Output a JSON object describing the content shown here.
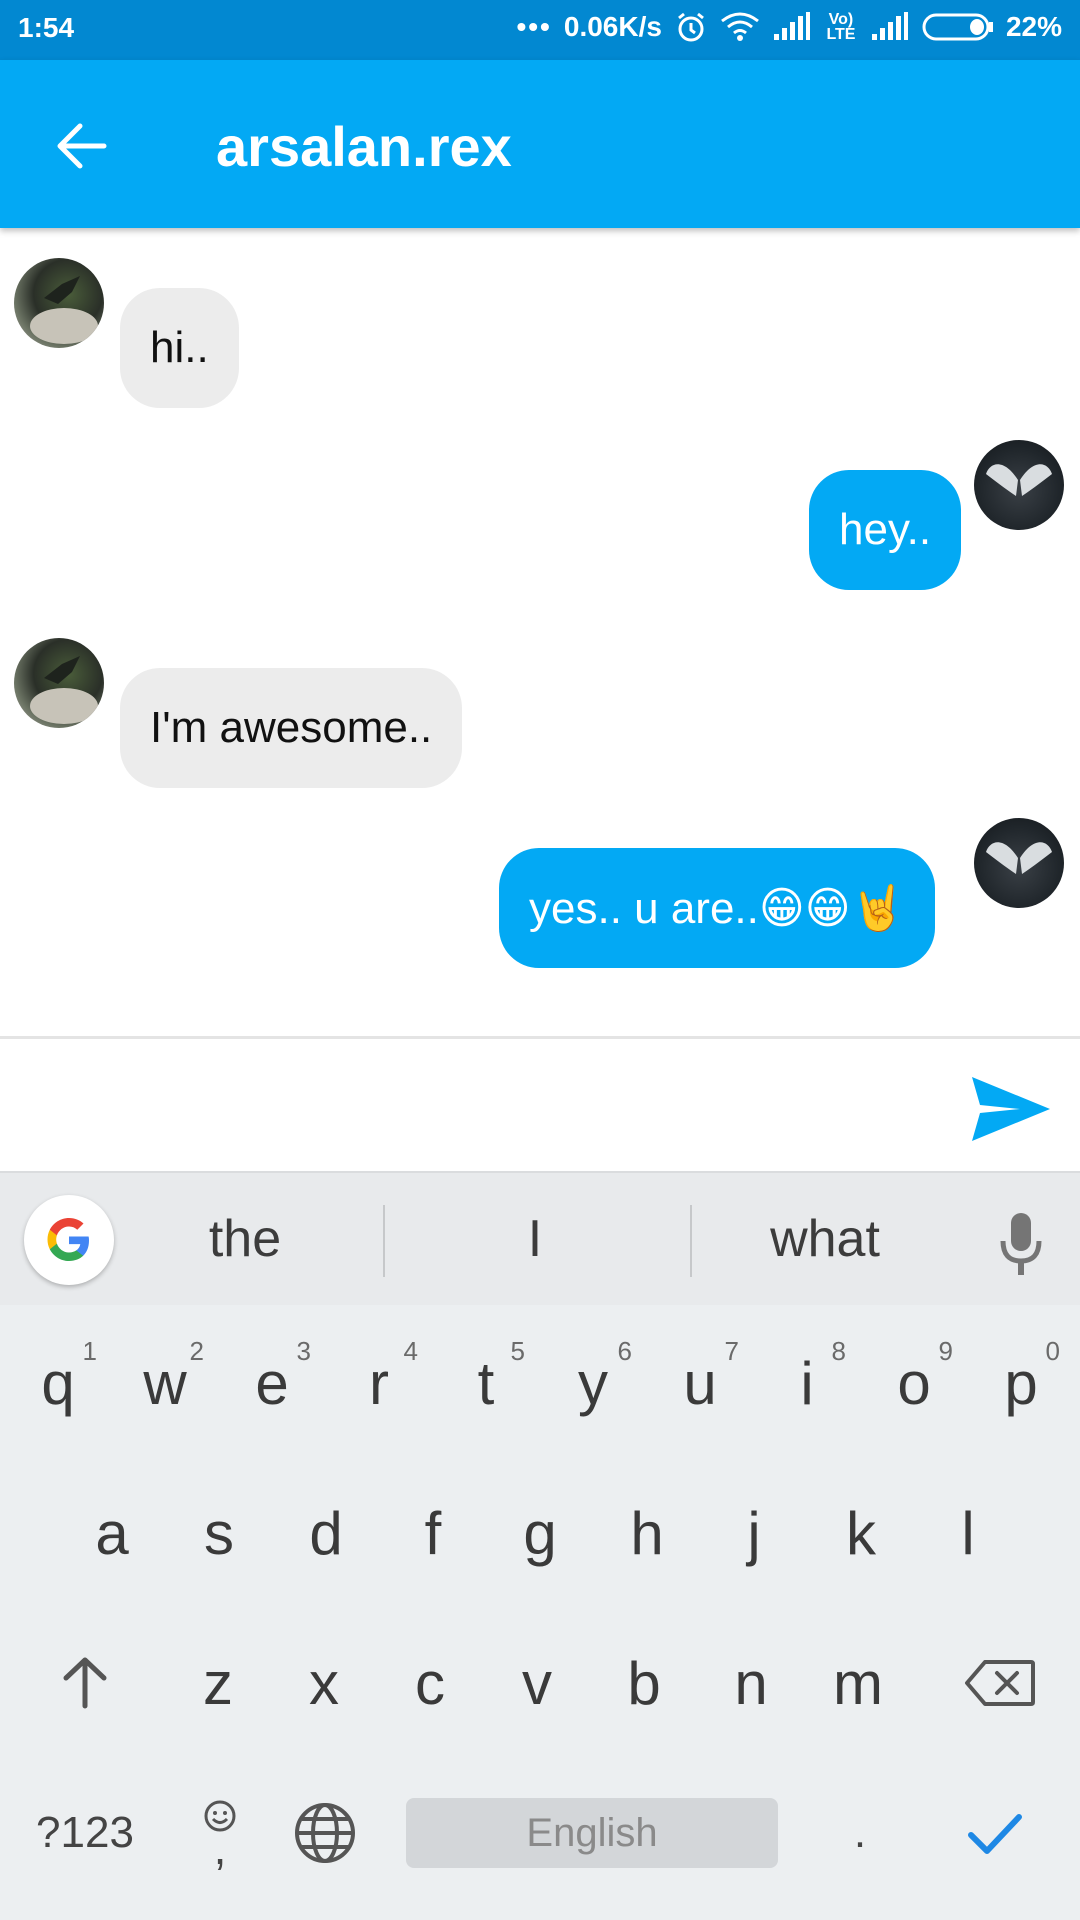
{
  "status_bar": {
    "time": "1:54",
    "network_speed": "0.06K/s",
    "volte_label": "Vo) LTE",
    "battery": "22%",
    "icons": [
      "more-dots-icon",
      "alarm-icon",
      "wifi-icon",
      "signal-icon",
      "volte-icon",
      "signal-icon-2",
      "battery-icon"
    ]
  },
  "app_bar": {
    "title": "arsalan.rex",
    "back_icon": "arrow-back-icon",
    "color": "#03a9f4"
  },
  "messages": [
    {
      "direction": "incoming",
      "text": "hi.."
    },
    {
      "direction": "outgoing",
      "text": "hey.."
    },
    {
      "direction": "incoming",
      "text": "I'm awesome.."
    },
    {
      "direction": "outgoing",
      "text": "yes.. u are..😁😁🤘"
    }
  ],
  "composer": {
    "value": "",
    "placeholder": "",
    "send_icon": "send-icon"
  },
  "keyboard": {
    "suggestions": [
      "the",
      "I",
      "what"
    ],
    "row1": [
      {
        "key": "q",
        "hint": "1"
      },
      {
        "key": "w",
        "hint": "2"
      },
      {
        "key": "e",
        "hint": "3"
      },
      {
        "key": "r",
        "hint": "4"
      },
      {
        "key": "t",
        "hint": "5"
      },
      {
        "key": "y",
        "hint": "6"
      },
      {
        "key": "u",
        "hint": "7"
      },
      {
        "key": "i",
        "hint": "8"
      },
      {
        "key": "o",
        "hint": "9"
      },
      {
        "key": "p",
        "hint": "0"
      }
    ],
    "row2": [
      "a",
      "s",
      "d",
      "f",
      "g",
      "h",
      "j",
      "k",
      "l"
    ],
    "row3": [
      "z",
      "x",
      "c",
      "v",
      "b",
      "n",
      "m"
    ],
    "symbols_label": "?123",
    "comma_label": ",",
    "space_label": "English",
    "period_label": ".",
    "icons": [
      "google-icon",
      "mic-icon",
      "shift-icon",
      "backspace-icon",
      "emoji-icon",
      "globe-icon",
      "check-icon"
    ]
  },
  "colors": {
    "accent": "#03a9f4",
    "status_bar": "#0288d1",
    "incoming_bubble": "#ececec"
  }
}
